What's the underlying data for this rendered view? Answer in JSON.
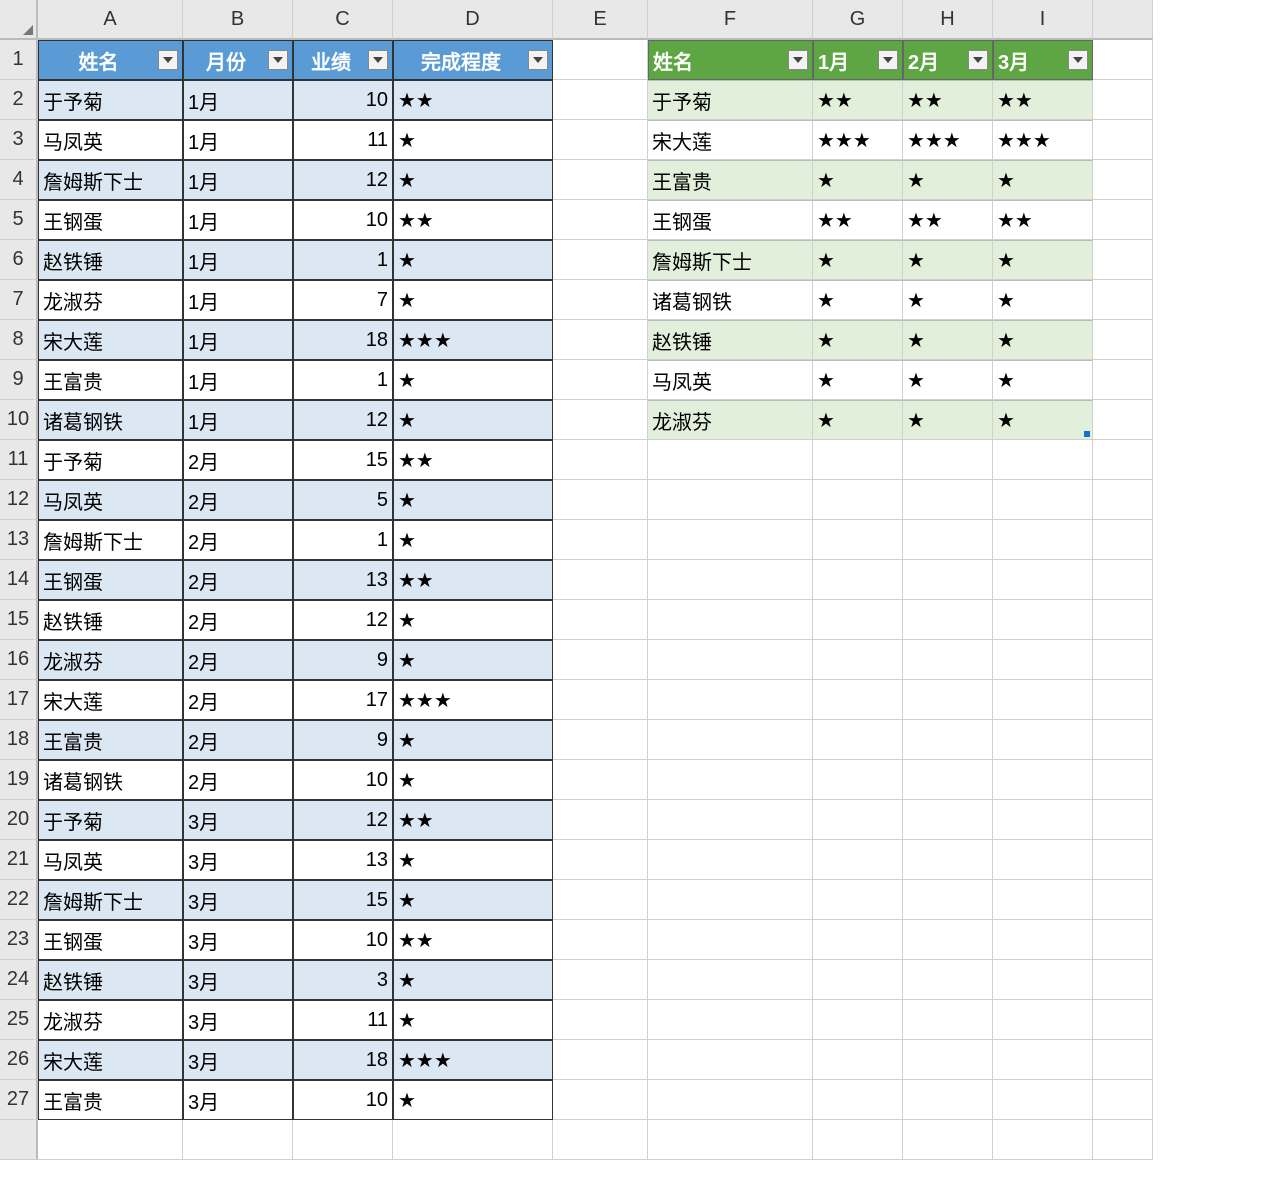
{
  "columns": [
    "A",
    "B",
    "C",
    "D",
    "E",
    "F",
    "G",
    "H",
    "I",
    ""
  ],
  "row_numbers": [
    "1",
    "2",
    "3",
    "4",
    "5",
    "6",
    "7",
    "8",
    "9",
    "10",
    "11",
    "12",
    "13",
    "14",
    "15",
    "16",
    "17",
    "18",
    "19",
    "20",
    "21",
    "22",
    "23",
    "24",
    "25",
    "26",
    "27",
    ""
  ],
  "blue": {
    "headers": {
      "A": "姓名",
      "B": "月份",
      "C": "业绩",
      "D": "完成程度"
    },
    "rows": [
      {
        "A": "于予菊",
        "B": "1月",
        "C": "10",
        "D": "★★"
      },
      {
        "A": "马凤英",
        "B": "1月",
        "C": "11",
        "D": "★"
      },
      {
        "A": "詹姆斯下士",
        "B": "1月",
        "C": "12",
        "D": "★"
      },
      {
        "A": "王钢蛋",
        "B": "1月",
        "C": "10",
        "D": "★★"
      },
      {
        "A": "赵铁锤",
        "B": "1月",
        "C": "1",
        "D": "★"
      },
      {
        "A": "龙淑芬",
        "B": "1月",
        "C": "7",
        "D": "★"
      },
      {
        "A": "宋大莲",
        "B": "1月",
        "C": "18",
        "D": "★★★"
      },
      {
        "A": "王富贵",
        "B": "1月",
        "C": "1",
        "D": "★"
      },
      {
        "A": "诸葛钢铁",
        "B": "1月",
        "C": "12",
        "D": "★"
      },
      {
        "A": "于予菊",
        "B": "2月",
        "C": "15",
        "D": "★★"
      },
      {
        "A": "马凤英",
        "B": "2月",
        "C": "5",
        "D": "★"
      },
      {
        "A": "詹姆斯下士",
        "B": "2月",
        "C": "1",
        "D": "★"
      },
      {
        "A": "王钢蛋",
        "B": "2月",
        "C": "13",
        "D": "★★"
      },
      {
        "A": "赵铁锤",
        "B": "2月",
        "C": "12",
        "D": "★"
      },
      {
        "A": "龙淑芬",
        "B": "2月",
        "C": "9",
        "D": "★"
      },
      {
        "A": "宋大莲",
        "B": "2月",
        "C": "17",
        "D": "★★★"
      },
      {
        "A": "王富贵",
        "B": "2月",
        "C": "9",
        "D": "★"
      },
      {
        "A": "诸葛钢铁",
        "B": "2月",
        "C": "10",
        "D": "★"
      },
      {
        "A": "于予菊",
        "B": "3月",
        "C": "12",
        "D": "★★"
      },
      {
        "A": "马凤英",
        "B": "3月",
        "C": "13",
        "D": "★"
      },
      {
        "A": "詹姆斯下士",
        "B": "3月",
        "C": "15",
        "D": "★"
      },
      {
        "A": "王钢蛋",
        "B": "3月",
        "C": "10",
        "D": "★★"
      },
      {
        "A": "赵铁锤",
        "B": "3月",
        "C": "3",
        "D": "★"
      },
      {
        "A": "龙淑芬",
        "B": "3月",
        "C": "11",
        "D": "★"
      },
      {
        "A": "宋大莲",
        "B": "3月",
        "C": "18",
        "D": "★★★"
      },
      {
        "A": "王富贵",
        "B": "3月",
        "C": "10",
        "D": "★"
      }
    ]
  },
  "green": {
    "headers": {
      "F": "姓名",
      "G": "1月",
      "H": "2月",
      "I": "3月"
    },
    "rows": [
      {
        "F": "于予菊",
        "G": "★★",
        "H": "★★",
        "I": "★★"
      },
      {
        "F": "宋大莲",
        "G": "★★★",
        "H": "★★★",
        "I": "★★★"
      },
      {
        "F": "王富贵",
        "G": "★",
        "H": "★",
        "I": "★"
      },
      {
        "F": "王钢蛋",
        "G": "★★",
        "H": "★★",
        "I": "★★"
      },
      {
        "F": "詹姆斯下士",
        "G": "★",
        "H": "★",
        "I": "★"
      },
      {
        "F": "诸葛钢铁",
        "G": "★",
        "H": "★",
        "I": "★"
      },
      {
        "F": "赵铁锤",
        "G": "★",
        "H": "★",
        "I": "★"
      },
      {
        "F": "马凤英",
        "G": "★",
        "H": "★",
        "I": "★"
      },
      {
        "F": "龙淑芬",
        "G": "★",
        "H": "★",
        "I": "★"
      }
    ]
  }
}
